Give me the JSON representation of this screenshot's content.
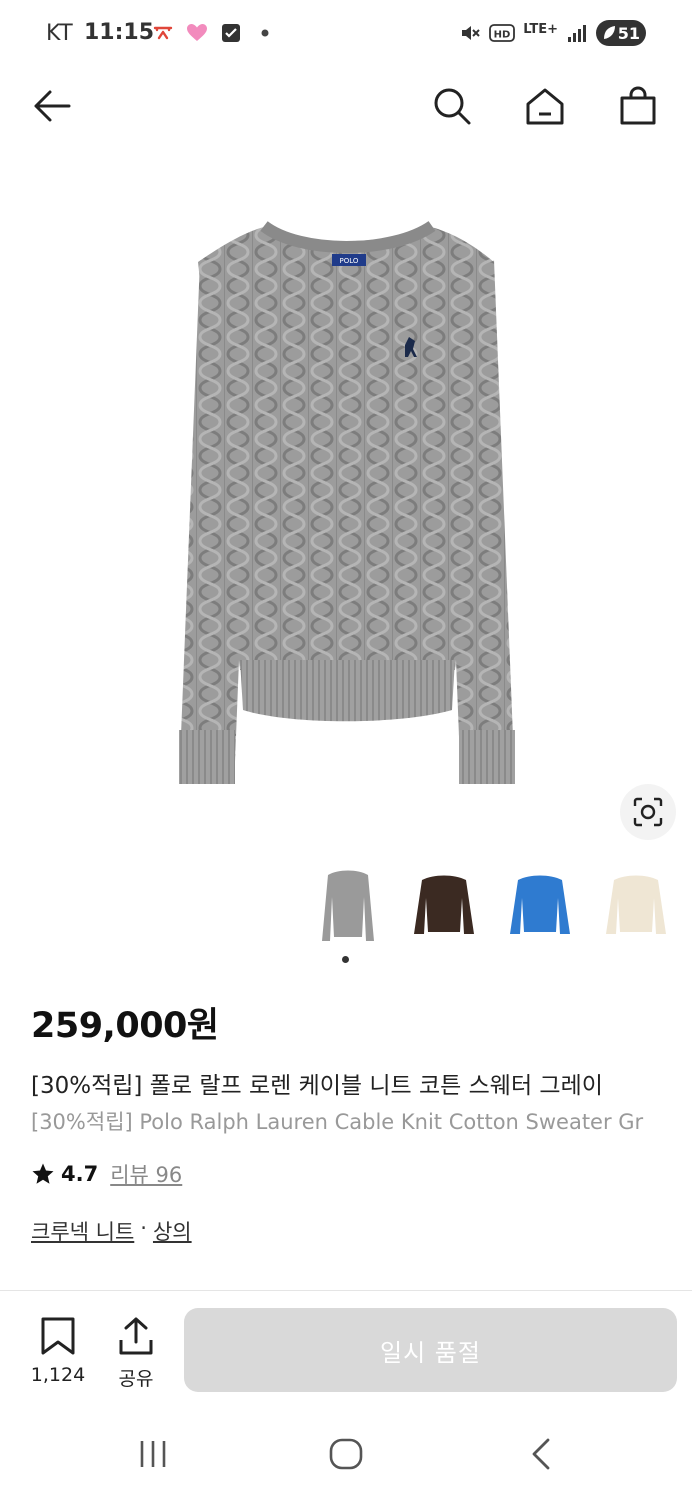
{
  "status_bar": {
    "carrier": "KT",
    "time": "11:15",
    "network": "LTE+",
    "hd": "HD",
    "battery": "51"
  },
  "icons": {
    "back": "back-arrow-icon",
    "search": "search-icon",
    "home": "home-icon",
    "cart": "shopping-bag-icon",
    "lens": "image-search-icon",
    "bookmark": "bookmark-icon",
    "share": "share-icon",
    "star": "star-icon"
  },
  "product": {
    "price": "259,000원",
    "title_ko": "[30%적립] 폴로 랄프 로렌 케이블 니트 코튼 스웨터 그레이",
    "title_en": "[30%적립] Polo Ralph Lauren Cable Knit Cotton Sweater Gr",
    "rating": "4.7",
    "review_label": "리뷰 96",
    "category_1": "크루넥 니트",
    "separator": "·",
    "category_2": "상의",
    "image_label": "POLO",
    "thumbnails": [
      {
        "color": "#9a9a9a",
        "name": "grey"
      },
      {
        "color": "#3b2a22",
        "name": "brown"
      },
      {
        "color": "#2f7bd0",
        "name": "blue"
      },
      {
        "color": "#efe6d4",
        "name": "cream"
      }
    ]
  },
  "bottom_bar": {
    "bookmark_count": "1,124",
    "share_label": "공유",
    "soldout_label": "일시 품절"
  },
  "colors": {
    "soldout_bg": "#d9d9d9",
    "sweater_grey": "#9c9c9c"
  }
}
